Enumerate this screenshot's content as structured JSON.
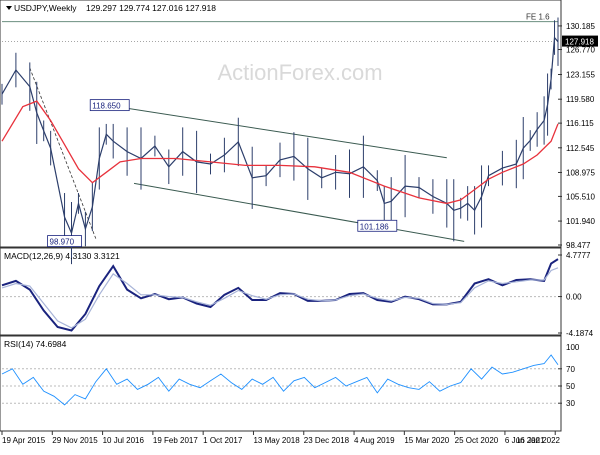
{
  "chart_data": [
    {
      "type": "line",
      "panel": "price",
      "title": "USDJPY,Weekly",
      "ohlc_text": "129.297 129.774 127.016 127.918",
      "watermark": "ActionForex.com",
      "ylim": [
        98.477,
        132.2
      ],
      "y_ticks": [
        "130.185",
        "126.770",
        "123.155",
        "119.580",
        "116.115",
        "112.545",
        "108.975",
        "105.510",
        "101.940",
        "98.477"
      ],
      "last_price_tag": "127.918",
      "fe_label": "FE 1.6",
      "fe_level": 130.8,
      "dotted_level": 127.918,
      "annotations": [
        {
          "text": "118.650",
          "x": 31,
          "y": 118.65
        },
        {
          "text": "98.970",
          "x": 18,
          "y": 98.97
        },
        {
          "text": "101.186",
          "x": 108,
          "y": 101.186
        }
      ],
      "trend_channel": {
        "upper": [
          [
            31,
            118.65
          ],
          [
            128,
            111.1
          ]
        ],
        "lower": [
          [
            38,
            107.4
          ],
          [
            133,
            99.0
          ]
        ]
      },
      "dashed_line": [
        [
          8,
          124.1
        ],
        [
          27,
          99.4
        ]
      ],
      "series": [
        {
          "name": "price",
          "x": [
            0,
            4,
            8,
            10,
            12,
            14,
            18,
            20,
            22,
            24,
            26,
            28,
            30,
            32,
            36,
            40,
            44,
            48,
            52,
            56,
            60,
            64,
            68,
            72,
            76,
            80,
            84,
            88,
            92,
            96,
            100,
            104,
            108,
            110,
            112,
            116,
            120,
            124,
            128,
            130,
            132,
            134,
            136,
            138,
            140,
            144,
            148,
            150,
            152,
            154,
            156,
            157,
            158,
            159,
            160
          ],
          "values": [
            120.3,
            123.8,
            121.4,
            117.6,
            115.0,
            112.5,
            102.5,
            100.2,
            104.5,
            100.8,
            104.0,
            111.0,
            114.5,
            113.5,
            112.0,
            111.0,
            112.8,
            109.8,
            112.0,
            110.5,
            110.2,
            111.5,
            113.4,
            108.2,
            108.5,
            110.8,
            111.3,
            109.5,
            108.2,
            109.0,
            108.8,
            109.8,
            107.8,
            104.5,
            104.8,
            107.0,
            106.8,
            105.5,
            104.5,
            103.5,
            103.8,
            104.5,
            103.5,
            105.5,
            108.5,
            109.6,
            110.2,
            112.5,
            113.6,
            115.2,
            116.5,
            118.8,
            122.5,
            128.5,
            127.9
          ]
        },
        {
          "name": "ma",
          "x": [
            0,
            6,
            10,
            14,
            18,
            22,
            26,
            30,
            34,
            40,
            50,
            60,
            70,
            80,
            90,
            100,
            110,
            120,
            128,
            132,
            136,
            140,
            144,
            150,
            154,
            158,
            160
          ],
          "values": [
            113.5,
            118.5,
            119.3,
            116.5,
            113.0,
            109.5,
            107.5,
            109.0,
            110.5,
            111.0,
            111.0,
            110.5,
            110.0,
            110.0,
            109.8,
            109.0,
            107.0,
            105.3,
            104.5,
            105.0,
            106.5,
            108.0,
            109.0,
            110.2,
            111.5,
            113.5,
            116.0
          ]
        }
      ]
    },
    {
      "type": "line",
      "panel": "macd",
      "title": "MACD(12,26,9) 4.3130 3.3121",
      "ylim": [
        -4.1874,
        4.7777
      ],
      "y_ticks": [
        "4.7777",
        "0.00",
        "-4.1874"
      ],
      "series": [
        {
          "name": "macd",
          "x": [
            0,
            4,
            8,
            12,
            16,
            20,
            24,
            28,
            32,
            36,
            40,
            44,
            48,
            52,
            56,
            60,
            64,
            68,
            72,
            76,
            80,
            84,
            88,
            92,
            96,
            100,
            104,
            108,
            112,
            116,
            120,
            124,
            128,
            132,
            136,
            140,
            144,
            148,
            152,
            156,
            158,
            160
          ],
          "values": [
            1.3,
            1.8,
            0.8,
            -1.6,
            -3.5,
            -3.9,
            -2.0,
            1.2,
            3.5,
            0.8,
            -0.2,
            0.3,
            -0.3,
            -0.1,
            -0.8,
            -1.2,
            0.2,
            1.0,
            -0.4,
            -0.4,
            0.4,
            0.3,
            -0.5,
            -0.5,
            -0.4,
            0.3,
            0.4,
            -0.4,
            -0.6,
            0.0,
            -0.3,
            -0.9,
            -0.9,
            -0.6,
            1.5,
            2.0,
            1.3,
            1.9,
            2.0,
            1.8,
            3.8,
            4.31
          ]
        },
        {
          "name": "signal",
          "x": [
            0,
            4,
            8,
            12,
            16,
            20,
            24,
            28,
            32,
            36,
            40,
            44,
            48,
            52,
            56,
            60,
            64,
            68,
            72,
            76,
            80,
            84,
            88,
            92,
            96,
            100,
            104,
            108,
            112,
            116,
            120,
            124,
            128,
            132,
            136,
            140,
            144,
            148,
            152,
            156,
            158,
            160
          ],
          "values": [
            1.0,
            1.5,
            1.2,
            -0.8,
            -2.8,
            -3.6,
            -2.6,
            0.2,
            2.6,
            1.5,
            0.2,
            0.2,
            0.0,
            -0.1,
            -0.6,
            -1.0,
            -0.2,
            0.7,
            0.1,
            -0.3,
            0.2,
            0.3,
            -0.3,
            -0.5,
            -0.4,
            0.1,
            0.3,
            -0.2,
            -0.5,
            -0.1,
            -0.2,
            -0.8,
            -0.9,
            -0.7,
            1.0,
            1.8,
            1.5,
            1.7,
            1.9,
            1.9,
            3.0,
            3.31
          ]
        }
      ]
    },
    {
      "type": "line",
      "panel": "rsi",
      "title": "RSI(14) 74.6984",
      "ylim": [
        0,
        100
      ],
      "y_ticks": [
        "70",
        "50",
        "30"
      ],
      "top_tick": "100",
      "series": [
        {
          "name": "rsi",
          "x": [
            0,
            3,
            6,
            9,
            12,
            15,
            18,
            21,
            24,
            27,
            30,
            33,
            36,
            39,
            42,
            45,
            48,
            51,
            54,
            57,
            60,
            63,
            66,
            69,
            72,
            75,
            78,
            81,
            84,
            87,
            90,
            93,
            96,
            99,
            102,
            105,
            108,
            111,
            114,
            117,
            120,
            123,
            126,
            129,
            132,
            135,
            138,
            141,
            144,
            147,
            150,
            153,
            156,
            158,
            160
          ],
          "values": [
            64,
            70,
            52,
            60,
            44,
            38,
            28,
            40,
            35,
            55,
            70,
            52,
            58,
            46,
            52,
            60,
            44,
            58,
            52,
            48,
            56,
            64,
            54,
            46,
            58,
            52,
            60,
            44,
            56,
            60,
            48,
            54,
            60,
            50,
            55,
            60,
            42,
            58,
            52,
            48,
            46,
            55,
            44,
            50,
            54,
            70,
            58,
            72,
            64,
            66,
            70,
            74,
            76,
            86,
            74.7
          ]
        }
      ]
    }
  ],
  "x_axis_labels": [
    "19 Apr 2015",
    "29 Nov 2015",
    "10 Jul 2016",
    "19 Feb 2017",
    "1 Oct 2017",
    "13 May 2018",
    "23 Dec 2018",
    "4 Aug 2019",
    "15 Mar 2020",
    "25 Oct 2020",
    "6 Jun 2021",
    "16 Jan 2022"
  ],
  "colors": {
    "price": "#2c3e6b",
    "ma": "#e8323c",
    "macd": "#1a237e",
    "signal": "#a8b4d8",
    "rsi": "#1e90ff",
    "channel": "#3a5a50",
    "axis_text": "#000000"
  }
}
